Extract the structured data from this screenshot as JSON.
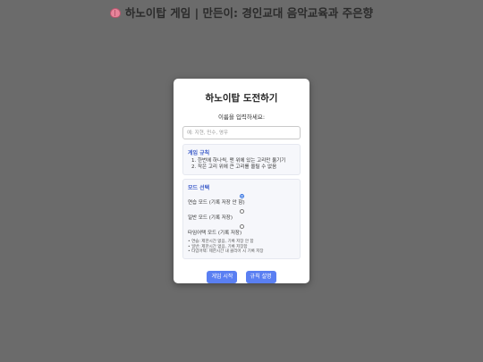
{
  "page": {
    "title": "하노이탑 게임 | 만든이: 경인교대 음악교육과 주은향",
    "title_icon": "brain-icon"
  },
  "modal": {
    "title": "하노이탑 도전하기",
    "prompt": "이름을 입력하세요:",
    "name_input": {
      "value": "",
      "placeholder": "예: 지현, 민수, 영우"
    },
    "rules": {
      "title": "게임 규칙",
      "items": [
        "1. 한번에 하나씩, 맨 위에 있는 고리만 옮기기",
        "2. 작은 고리 위에 큰 고리를 올릴 수 없음"
      ]
    },
    "modes": {
      "title": "모드 선택",
      "options": [
        {
          "label": "연습 모드 (기록 저장 안 함)",
          "checked": true
        },
        {
          "label": "일반 모드 (기록 저장)",
          "checked": false
        },
        {
          "label": "타임어택 모드 (기록 저장)",
          "checked": false
        }
      ],
      "notes": [
        "• 연습: 제한시간 없음, 기록 저장 안 함",
        "• 일반: 제한시간 없음, 기록 저장함",
        "• 타임어택: 제한시간 내 클리어 시 기록 저장"
      ]
    },
    "buttons": {
      "start": "게임 시작",
      "rules": "규칙 설명"
    }
  },
  "colors": {
    "accent": "#5a7ff2",
    "section_title": "#3b5bc9",
    "overlay": "#6b6b6b"
  }
}
